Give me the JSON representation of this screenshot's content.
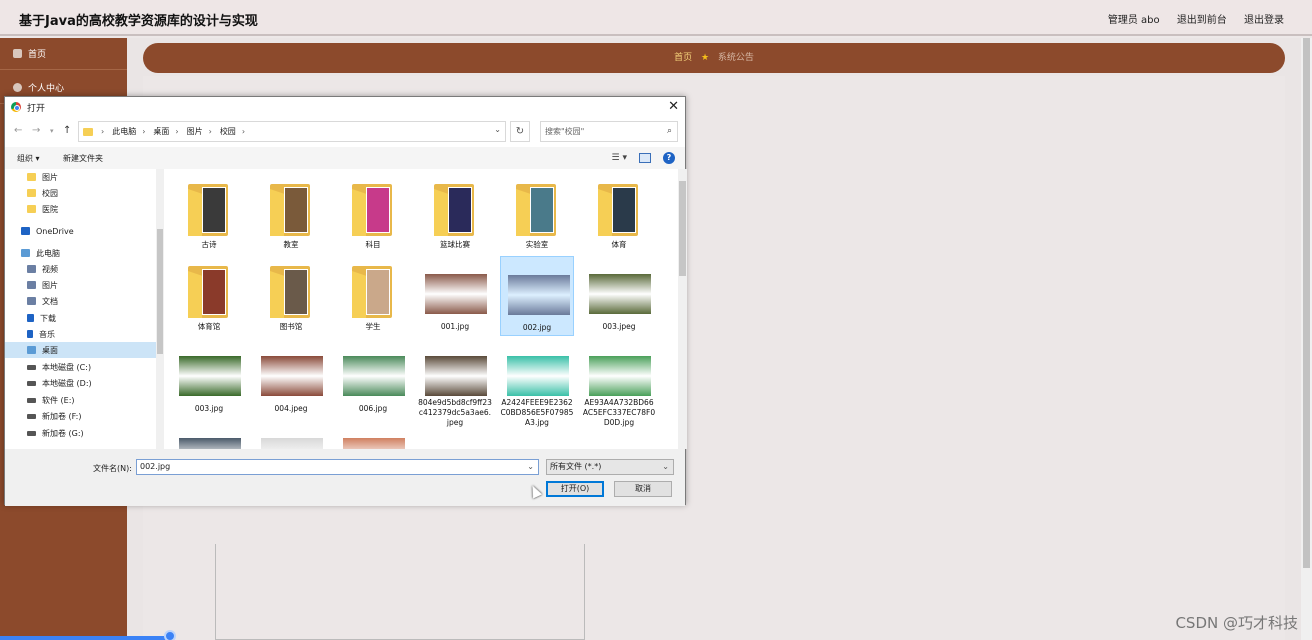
{
  "header": {
    "title": "基于Java的高校教学资源库的设计与实现",
    "user": "管理员 abo",
    "back_to_front": "退出到前台",
    "logout": "退出登录"
  },
  "sidebar": {
    "items": [
      {
        "label": "首页",
        "icon": "home-icon"
      },
      {
        "label": "个人中心",
        "icon": "user-icon"
      }
    ]
  },
  "nav": {
    "home": "首页",
    "star": "★",
    "notice": "系统公告"
  },
  "dialog": {
    "title": "打开",
    "close": "✕",
    "breadcrumbs": [
      "此电脑",
      "桌面",
      "图片",
      "校园"
    ],
    "search_placeholder": "搜索\"校园\"",
    "toolbar": {
      "organize": "组织 ▾",
      "new_folder": "新建文件夹",
      "help": "?"
    },
    "nav_pane": [
      {
        "label": "图片",
        "type": "folder"
      },
      {
        "label": "校园",
        "type": "folder"
      },
      {
        "label": "医院",
        "type": "folder"
      },
      {
        "label": "OneDrive",
        "type": "onedrive"
      },
      {
        "label": "此电脑",
        "type": "pc"
      },
      {
        "label": "视频",
        "type": "media"
      },
      {
        "label": "图片",
        "type": "media"
      },
      {
        "label": "文档",
        "type": "media"
      },
      {
        "label": "下载",
        "type": "download"
      },
      {
        "label": "音乐",
        "type": "music"
      },
      {
        "label": "桌面",
        "type": "pc",
        "selected": true
      },
      {
        "label": "本地磁盘 (C:)",
        "type": "drive"
      },
      {
        "label": "本地磁盘 (D:)",
        "type": "drive"
      },
      {
        "label": "软件 (E:)",
        "type": "drive"
      },
      {
        "label": "新加卷 (F:)",
        "type": "drive"
      },
      {
        "label": "新加卷 (G:)",
        "type": "drive"
      }
    ],
    "files": [
      {
        "name": "古诗",
        "kind": "folder",
        "color": "#3a3a3a"
      },
      {
        "name": "教室",
        "kind": "folder",
        "color": "#7a5a3a"
      },
      {
        "name": "科目",
        "kind": "folder",
        "color": "#c73a8a"
      },
      {
        "name": "篮球比赛",
        "kind": "folder",
        "color": "#2a2a5a"
      },
      {
        "name": "实验室",
        "kind": "folder",
        "color": "#4a7a8a"
      },
      {
        "name": "体育",
        "kind": "folder",
        "color": "#2a3a4a"
      },
      {
        "name": "体育馆",
        "kind": "folder",
        "color": "#8a3a2a"
      },
      {
        "name": "图书馆",
        "kind": "folder",
        "color": "#6a5a4a"
      },
      {
        "name": "学生",
        "kind": "folder",
        "color": "#caa88a"
      },
      {
        "name": "001.jpg",
        "kind": "image",
        "color": "#8a5a4a"
      },
      {
        "name": "002.jpg",
        "kind": "image",
        "color": "#6a7a9a",
        "selected": true
      },
      {
        "name": "003.jpeg",
        "kind": "image",
        "color": "#5a6a3a"
      },
      {
        "name": "003.jpg",
        "kind": "image",
        "color": "#3a6a2a"
      },
      {
        "name": "004.jpeg",
        "kind": "image",
        "color": "#8a4a3a"
      },
      {
        "name": "006.jpg",
        "kind": "image",
        "color": "#4a8a5a"
      },
      {
        "name": "804e9d5bd8cf9ff23c412379dc5a3ae6.jpeg",
        "kind": "image",
        "color": "#5a4a3a"
      },
      {
        "name": "A2424FEEE9E2362C0BD856E5F07985A3.jpg",
        "kind": "image",
        "color": "#3ac0a8"
      },
      {
        "name": "AE93A4A732BD66AC5EFC337EC78F0D0D.jpg",
        "kind": "image",
        "color": "#4aa05a"
      },
      {
        "name": "",
        "kind": "image",
        "color": "#4a5a6a"
      },
      {
        "name": "",
        "kind": "image",
        "color": "#d8d8d8"
      },
      {
        "name": "",
        "kind": "image",
        "color": "#d08060"
      }
    ],
    "file_name_label": "文件名(N):",
    "file_name_value": "002.jpg",
    "file_type": "所有文件 (*.*)",
    "open_button": "打开(O)",
    "cancel_button": "取消"
  },
  "watermark": "CSDN @巧才科技"
}
